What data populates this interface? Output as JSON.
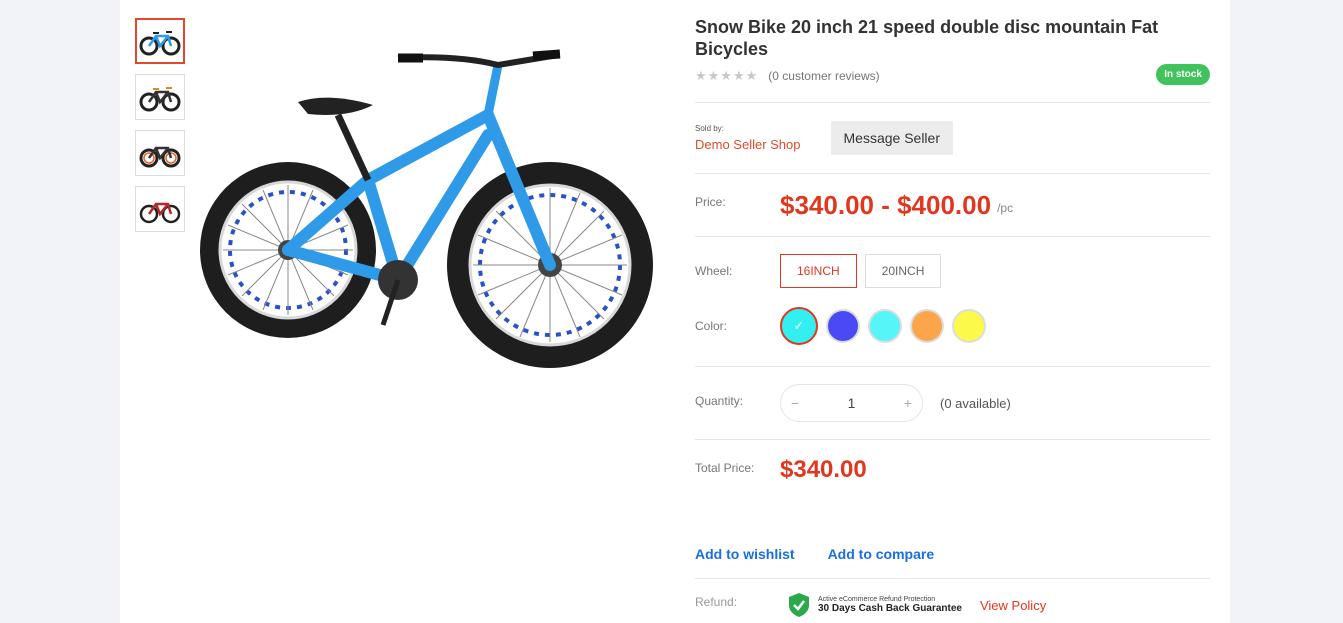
{
  "product": {
    "title": "Snow Bike 20 inch 21 speed double disc mountain Fat Bicycles",
    "stars": "★★★★★",
    "reviews": "(0 customer reviews)",
    "stock": "In stock"
  },
  "seller": {
    "sold_by_label": "Sold by:",
    "name": "Demo Seller Shop",
    "message_button": "Message Seller"
  },
  "price": {
    "label": "Price:",
    "value": "$340.00 - $400.00",
    "unit": "/pc"
  },
  "wheel": {
    "label": "Wheel:",
    "options": [
      "16INCH",
      "20INCH"
    ]
  },
  "color": {
    "label": "Color:",
    "swatches": [
      "#33f0f0",
      "#4a4af5",
      "#55f5f8",
      "#fda54a",
      "#fcf94a"
    ],
    "check": "✓"
  },
  "quantity": {
    "label": "Quantity:",
    "minus": "−",
    "value": "1",
    "plus": "+",
    "available": "(0 available)"
  },
  "total": {
    "label": "Total Price:",
    "value": "$340.00"
  },
  "links": {
    "wishlist": "Add to wishlist",
    "compare": "Add to compare"
  },
  "refund": {
    "label": "Refund:",
    "small": "Active eCommerce Refund Protection",
    "big": "30 Days Cash Back Guarantee",
    "policy": "View Policy"
  },
  "colors": {
    "accent": "#e0371f",
    "link": "#1a6fe0",
    "stock": "#3fc35a",
    "bike": "#2f9be8"
  }
}
